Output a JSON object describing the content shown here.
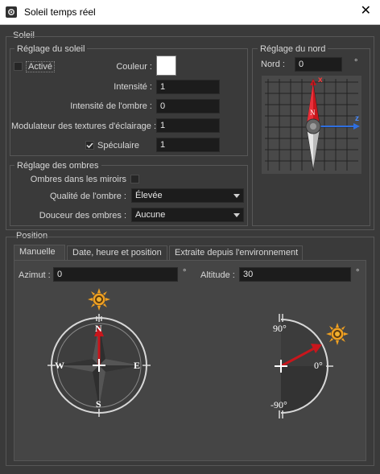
{
  "window": {
    "title": "Soleil temps réel",
    "close_glyph": "✕",
    "app_icon": "gear-icon"
  },
  "soleil": {
    "group_title": "Soleil",
    "reglage_soleil": {
      "title": "Réglage du soleil",
      "active_label": "Activé",
      "active_checked": false,
      "couleur_label": "Couleur :",
      "couleur_value": "#ffffff",
      "intensite_label": "Intensité :",
      "intensite_value": "1",
      "intensite_ombre_label": "Intensité de l'ombre :",
      "intensite_ombre_value": "0",
      "modulateur_label": "Modulateur des textures d'éclairage :",
      "modulateur_value": "1",
      "speculaire_label": "Spéculaire",
      "speculaire_checked": true,
      "speculaire_value": "1"
    },
    "reglage_nord": {
      "title": "Réglage du nord",
      "nord_label": "Nord :",
      "nord_value": "0",
      "unit": "°",
      "axis_x": "x",
      "axis_z": "z",
      "compass_letter": "N"
    },
    "reglage_ombres": {
      "title": "Réglage des ombres",
      "miroirs_label": "Ombres dans les miroirs",
      "miroirs_checked": false,
      "qualite_label": "Qualité de l'ombre :",
      "qualite_value": "Élevée",
      "douceur_label": "Douceur des ombres :",
      "douceur_value": "Aucune"
    }
  },
  "position": {
    "group_title": "Position",
    "tabs": [
      {
        "label": "Manuelle",
        "active": true
      },
      {
        "label": "Date, heure et position",
        "active": false
      },
      {
        "label": "Extraite depuis l'environnement",
        "active": false
      }
    ],
    "azimut_label": "Azimut :",
    "azimut_value": "0",
    "altitude_label": "Altitude :",
    "altitude_value": "30",
    "unit": "°",
    "compass": {
      "n": "N",
      "s": "S",
      "e": "E",
      "w": "W"
    },
    "elevation": {
      "top": "90°",
      "zero": "0°",
      "bottom": "-90°"
    }
  },
  "colors": {
    "accent_red": "#c8161c",
    "accent_blue": "#2f6fe0",
    "sun": "#f0a020",
    "background": "#3a3a3a",
    "field": "#1c1c1c"
  }
}
